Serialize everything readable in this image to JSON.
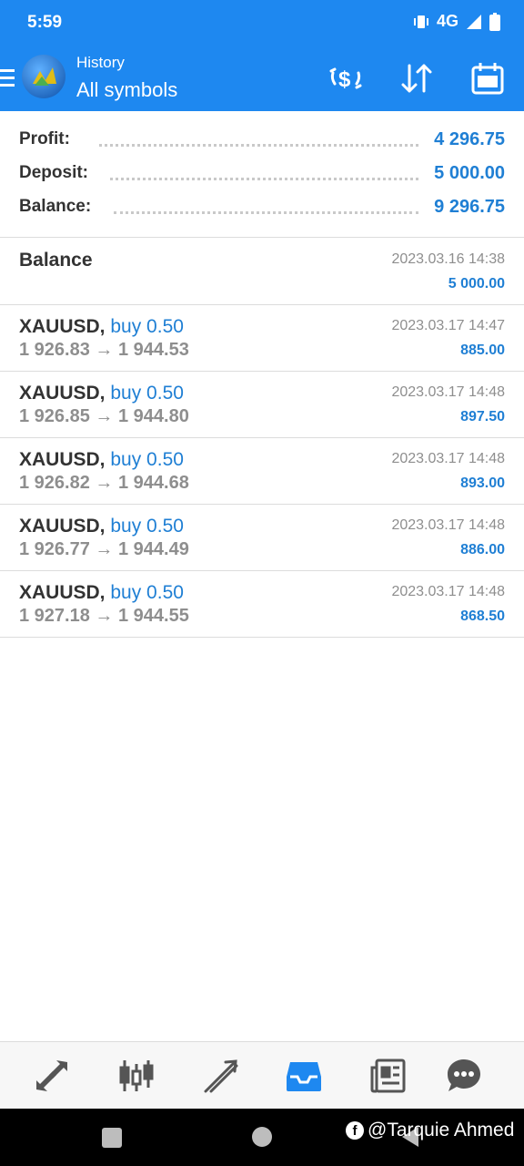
{
  "status_bar": {
    "time": "5:59",
    "network": "4G",
    "icons": [
      "vibrate-icon",
      "signal-icon",
      "battery-icon"
    ]
  },
  "app_bar": {
    "subtitle": "History",
    "title": "All symbols",
    "actions": [
      "currency-exchange-icon",
      "sort-icon",
      "calendar-icon"
    ]
  },
  "summary": {
    "profit_label": "Profit:",
    "profit_value": "4 296.75",
    "deposit_label": "Deposit:",
    "deposit_value": "5 000.00",
    "balance_label": "Balance:",
    "balance_value": "9 296.75"
  },
  "balance_entry": {
    "title": "Balance",
    "time": "2023.03.16 14:38",
    "amount": "5 000.00"
  },
  "trades": [
    {
      "symbol": "XAUUSD,",
      "side": "buy 0.50",
      "prices": "1 926.83 → 1 944.53",
      "time": "2023.03.17 14:47",
      "profit": "885.00"
    },
    {
      "symbol": "XAUUSD,",
      "side": "buy 0.50",
      "prices": "1 926.85 → 1 944.80",
      "time": "2023.03.17 14:48",
      "profit": "897.50"
    },
    {
      "symbol": "XAUUSD,",
      "side": "buy 0.50",
      "prices": "1 926.82 → 1 944.68",
      "time": "2023.03.17 14:48",
      "profit": "893.00"
    },
    {
      "symbol": "XAUUSD,",
      "side": "buy 0.50",
      "prices": "1 926.77 → 1 944.49",
      "time": "2023.03.17 14:48",
      "profit": "886.00"
    },
    {
      "symbol": "XAUUSD,",
      "side": "buy 0.50",
      "prices": "1 927.18 → 1 944.55",
      "time": "2023.03.17 14:48",
      "profit": "868.50"
    }
  ],
  "bottom_nav": [
    "quotes-icon",
    "chart-icon",
    "trade-icon",
    "history-icon",
    "news-icon",
    "chat-icon"
  ],
  "watermark": "@Tarquie Ahmed",
  "colors": {
    "accent": "#1e88f0",
    "value_blue": "#1f7fd4",
    "muted": "#8e8e8e"
  }
}
